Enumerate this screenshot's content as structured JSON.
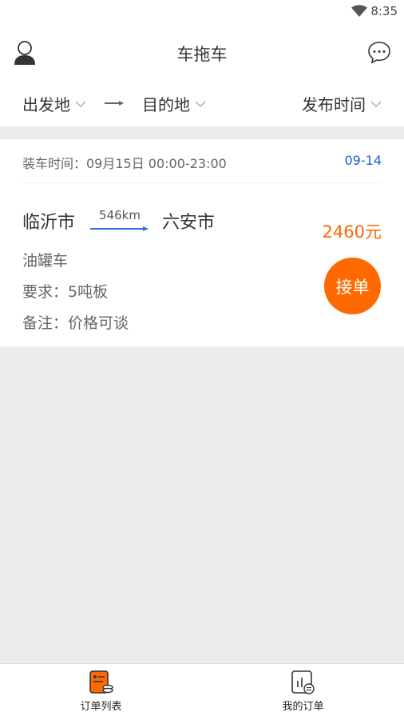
{
  "status": {
    "time": "8:35"
  },
  "header": {
    "title": "车拖车"
  },
  "filters": {
    "origin": "出发地",
    "destination": "目的地",
    "publish_time": "发布时间"
  },
  "order": {
    "load_time": "装车时间：09月15日 00:00-23:00",
    "date_badge": "09-14",
    "from_city": "临沂市",
    "distance": "546km",
    "to_city": "六安市",
    "price": "2460元",
    "vehicle_type": "油罐车",
    "requirement": "要求：5吨板",
    "note": "备注：价格可谈",
    "accept_label": "接单"
  },
  "tabs": [
    {
      "label": "订单列表",
      "icon": "order-list-icon",
      "active": true
    },
    {
      "label": "我的订单",
      "icon": "my-orders-icon",
      "active": false
    }
  ],
  "colors": {
    "accent": "#ff6a00",
    "price": "#ff6600",
    "link_blue": "#1a63d6",
    "route_line": "#2f6fe4"
  }
}
